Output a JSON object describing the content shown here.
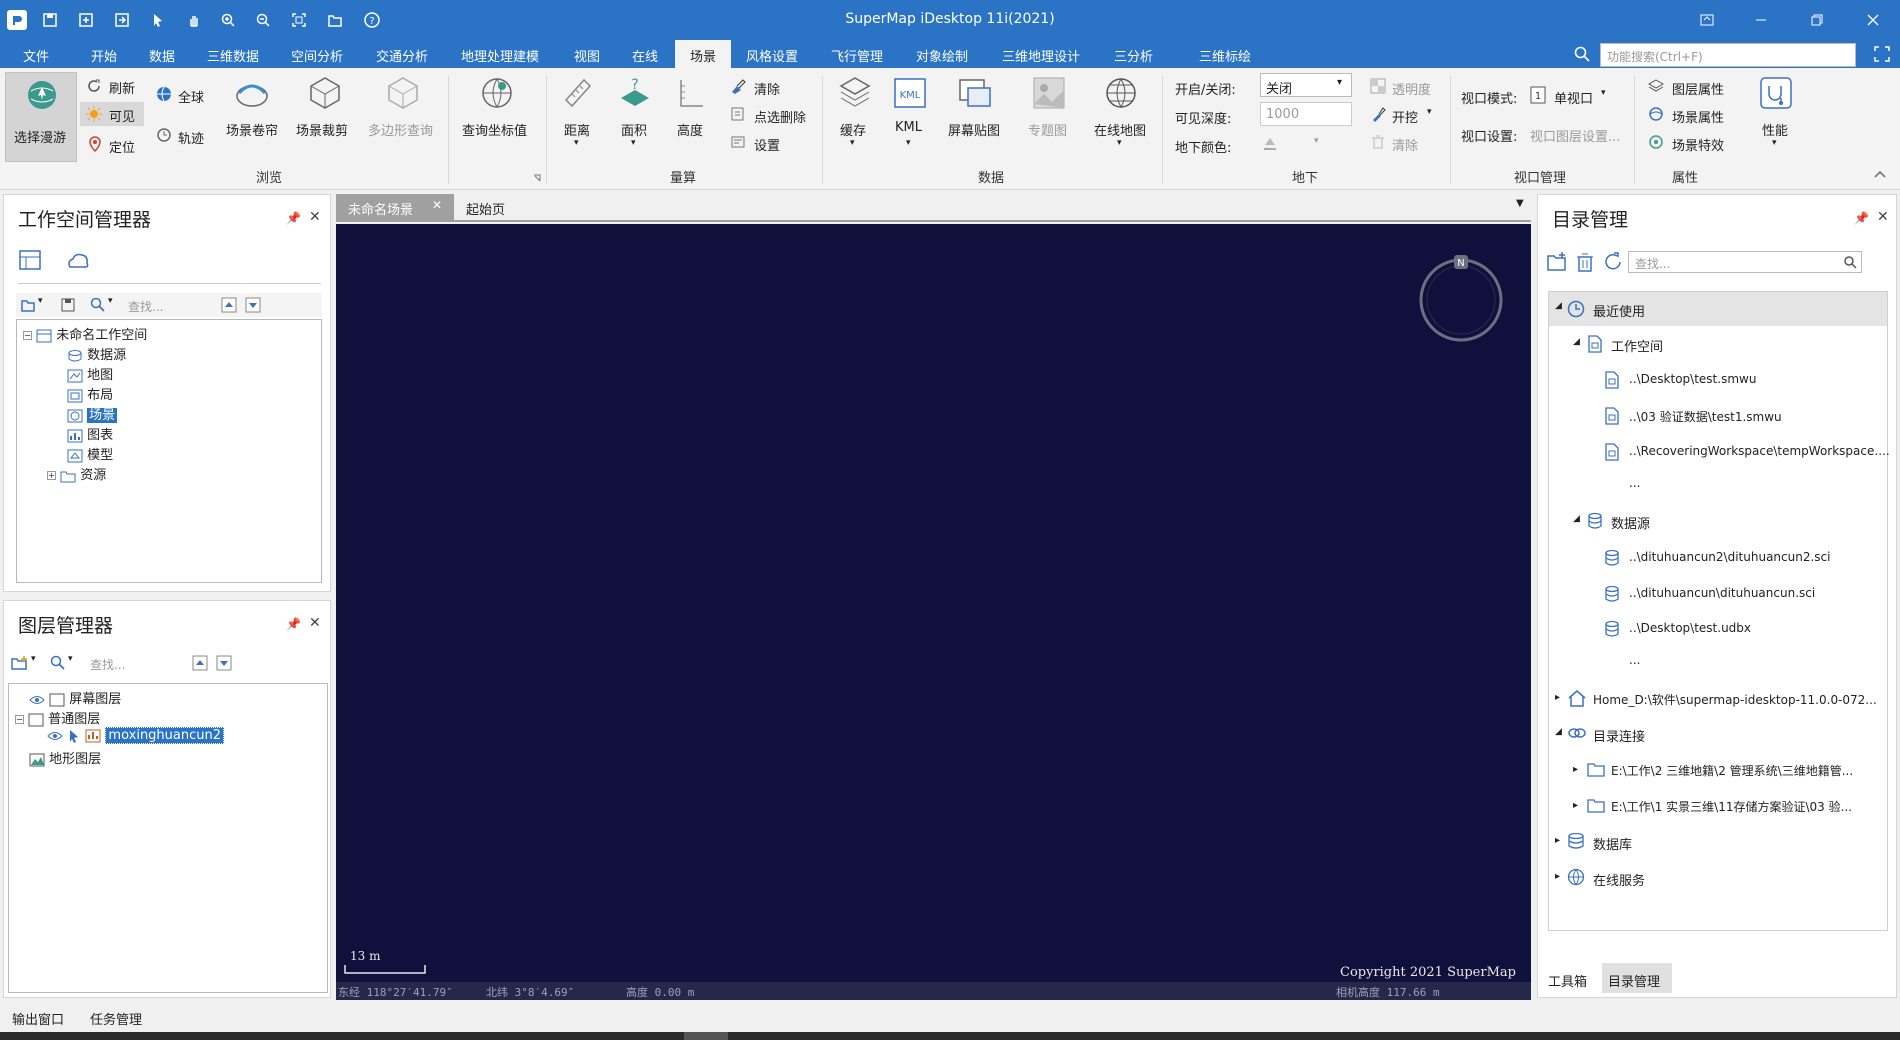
{
  "app": {
    "title": "SuperMap iDesktop 11i(2021)"
  },
  "quick_access": [
    {
      "icon": "app-logo-icon"
    },
    {
      "icon": "save-icon"
    },
    {
      "icon": "new-icon"
    },
    {
      "icon": "open-icon"
    },
    {
      "icon": "select-cursor-icon"
    },
    {
      "icon": "pan-hand-icon"
    },
    {
      "icon": "zoom-in-icon"
    },
    {
      "icon": "zoom-out-icon"
    },
    {
      "icon": "full-extent-icon"
    },
    {
      "icon": "folder-icon"
    },
    {
      "icon": "help-icon"
    }
  ],
  "menu": [
    "文件",
    "开始",
    "数据",
    "三维数据",
    "空间分析",
    "交通分析",
    "地理处理建模",
    "视图",
    "在线",
    "场景",
    "风格设置",
    "飞行管理",
    "对象绘制",
    "三维地理设计",
    "三分析",
    "三维标绘"
  ],
  "menu_active": "场景",
  "search_placeholder": "功能搜索(Ctrl+F)",
  "ribbon": {
    "browse": {
      "label": "浏览",
      "select_roam": "选择漫游",
      "refresh": "刷新",
      "globe": "全球",
      "visible": "可见",
      "track": "轨迹",
      "locate": "定位",
      "scene_curtain": "场景卷帘",
      "scene_clip": "场景裁剪",
      "polygon_query": "多边形查询",
      "query_coords": "查询坐标值"
    },
    "measure": {
      "label": "量算",
      "distance": "距离",
      "area": "面积",
      "height": "高度",
      "clear": "清除",
      "point_delete": "点选删除",
      "settings": "设置"
    },
    "data": {
      "label": "数据",
      "cache": "缓存",
      "kml": "KML",
      "screen_map": "屏幕贴图",
      "thematic": "专题图",
      "online_map": "在线地图"
    },
    "underground": {
      "label": "地下",
      "toggle_label": "开启/关闭:",
      "toggle_value": "关闭",
      "depth_label": "可见深度:",
      "depth_value": "1000",
      "color_label": "地下颜色:",
      "transparency": "透明度",
      "excavate": "开挖",
      "clear": "清除"
    },
    "viewport": {
      "label": "视口管理",
      "mode_label": "视口模式:",
      "mode_value": "单视口",
      "settings_label": "视口设置:",
      "layer_settings": "视口图层设置..."
    },
    "properties": {
      "label": "属性",
      "layer_props": "图层属性",
      "scene_props": "场景属性",
      "scene_effects": "场景特效",
      "performance": "性能"
    }
  },
  "workspace": {
    "title": "工作空间管理器",
    "search": "查找...",
    "root": "未命名工作空间",
    "items": [
      "数据源",
      "地图",
      "布局",
      "场景",
      "图表",
      "模型",
      "资源"
    ],
    "selected": "场景"
  },
  "layers": {
    "title": "图层管理器",
    "search": "查找...",
    "screen": "屏幕图层",
    "normal": "普通图层",
    "child": "moxinghuancun2",
    "terrain": "地形图层"
  },
  "tabs": [
    "未命名场景",
    "起始页"
  ],
  "scene": {
    "scale": "13 m",
    "copyright": "Copyright 2021 SuperMap",
    "status_lon": "东经 118°27′41.79″",
    "status_lat": "北纬 3°8′4.69″",
    "status_height": "高度 0.00 m",
    "camera": "相机高度 117.66 m",
    "compass": "N",
    "bg": "#10103c"
  },
  "catalog": {
    "title": "目录管理",
    "search": "查找...",
    "recent": "最近使用",
    "workspace": "工作空间",
    "ws_items": [
      "..\\Desktop\\test.smwu",
      "..\\03 验证数据\\test1.smwu",
      "..\\RecoveringWorkspace\\tempWorkspace....",
      "..."
    ],
    "datasource": "数据源",
    "ds_items": [
      "..\\dituhuancun2\\dituhuancun2.sci",
      "..\\dituhuancun\\dituhuancun.sci",
      "..\\Desktop\\test.udbx",
      "..."
    ],
    "home": "Home_D:\\软件\\supermap-idesktop-11.0.0-072...",
    "connections": "目录连接",
    "conn_items": [
      "E:\\工作\\2 三维地籍\\2 管理系统\\三维地籍管...",
      "E:\\工作\\1 实景三维\\11存储方案验证\\03 验..."
    ],
    "database": "数据库",
    "online": "在线服务",
    "bottom_tabs": [
      "工具箱",
      "目录管理"
    ]
  },
  "status_tabs": [
    "输出窗口",
    "任务管理"
  ],
  "colors": {
    "accent": "#2b73c5",
    "scene_bg": "#10103c"
  }
}
